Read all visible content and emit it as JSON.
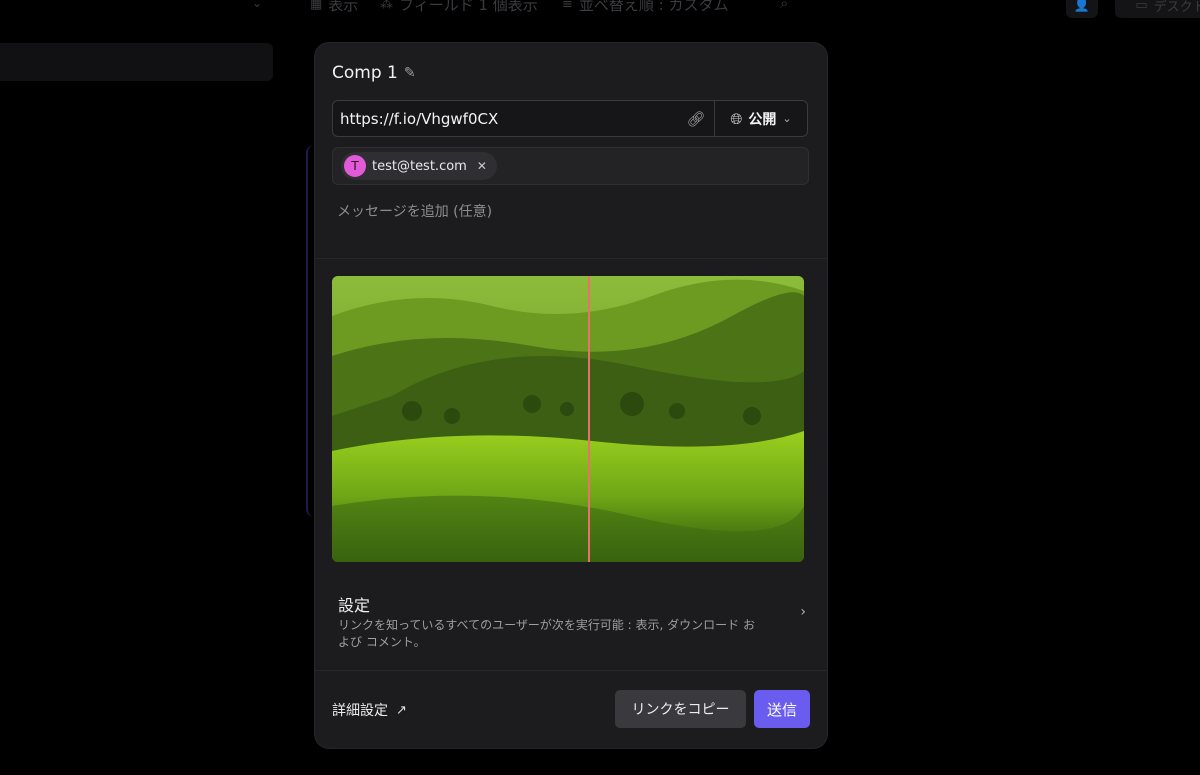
{
  "background": {
    "toolbar": {
      "view_label": "表示",
      "fields_label": "フィールド 1 個表示",
      "sort_label": "並べ替え順 : カスタム",
      "desktop_label": "デスクト"
    }
  },
  "dialog": {
    "title": "Comp 1",
    "link": {
      "url": "https://f.io/Vhgwf0CX",
      "visibility": "公開"
    },
    "recipients": [
      {
        "initial": "T",
        "email": "test@test.com"
      }
    ],
    "message_placeholder": "メッセージを追加 (任意)",
    "settings": {
      "title": "設定",
      "description": "リンクを知っているすべてのユーザーが次を実行可能 : 表示, ダウンロード および コメント。"
    },
    "advanced_label": "詳細設定",
    "copy_link_label": "リンクをコピー",
    "send_label": "送信"
  },
  "colors": {
    "accent": "#6b5cf0",
    "avatar": "#e25ad8",
    "compare_line": "#ee6d6d"
  },
  "icons": {
    "edit": "pencil-icon",
    "copy_link": "link-icon",
    "visibility": "globe-icon",
    "remove": "close-icon",
    "settings_expand": "chevron-right-icon",
    "advanced": "arrow-up-right-icon"
  }
}
